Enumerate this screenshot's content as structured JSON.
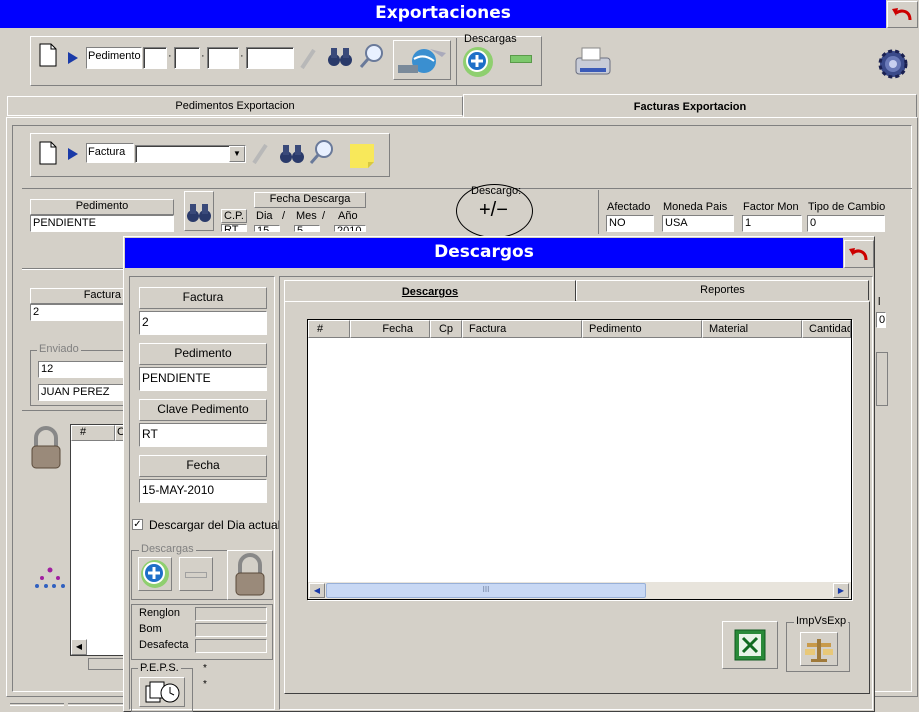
{
  "app": {
    "title": "Exportaciones"
  },
  "toolbar": {
    "pedimento_label": "Pedimento",
    "descargas_label": "Descargas"
  },
  "tabs": [
    "Pedimentos Exportacion",
    "Facturas Exportacion"
  ],
  "factura_bar": {
    "factura_label": "Factura"
  },
  "header_grid": {
    "pedimento_label": "Pedimento",
    "pedimento_value": "PENDIENTE",
    "cp_label": "C.P.",
    "cp_value": "RT",
    "fecha_descarga_label": "Fecha Descarga",
    "dia_label": "Dia",
    "mes_label": "Mes",
    "anio_label": "Año",
    "sep": "/",
    "dia_value": "15",
    "mes_value": "5",
    "anio_value": "2010",
    "descargo_label": "Descargo:",
    "descargo_symbol": "+/−",
    "afectado_label": "Afectado",
    "afectado_value": "NO",
    "moneda_label": "Moneda Pais",
    "moneda_value": "USA",
    "factor_label": "Factor Mon",
    "factor_value": "1",
    "tipo_cambio_label": "Tipo de Cambio",
    "tipo_cambio_value": "0"
  },
  "behind": {
    "factura_label": "Factura",
    "factura_value": "2",
    "enviado_label": "Enviado",
    "enviado_value": "12",
    "enviado_name": "JUAN PEREZ",
    "right_label": "l",
    "right_value": "0",
    "grid_hash": "#",
    "grid_col": "C"
  },
  "dialog": {
    "title": "Descargos",
    "left": {
      "factura_label": "Factura",
      "factura_value": "2",
      "pedimento_label": "Pedimento",
      "pedimento_value": "PENDIENTE",
      "clave_label": "Clave Pedimento",
      "clave_value": "RT",
      "fecha_label": "Fecha",
      "fecha_value": "15-MAY-2010",
      "checkbox_label": "Descargar del Dia actual",
      "checkbox_mark": "✓",
      "descargas_label": "Descargas",
      "renglon_label": "Renglon",
      "bom_label": "Bom",
      "desafecta_label": "Desafecta",
      "peps_label": "P.E.P.S.",
      "star": "*"
    },
    "tabs": [
      "Descargos",
      "Reportes"
    ],
    "grid_columns": [
      "#",
      "Fecha",
      "Cp",
      "Factura",
      "Pedimento",
      "Material",
      "Cantidad"
    ],
    "scroll_thumb": "III",
    "impvsexp_label": "ImpVsExp"
  },
  "colors": {
    "title_blue": "#0000ff",
    "face": "#d4d0c8"
  }
}
